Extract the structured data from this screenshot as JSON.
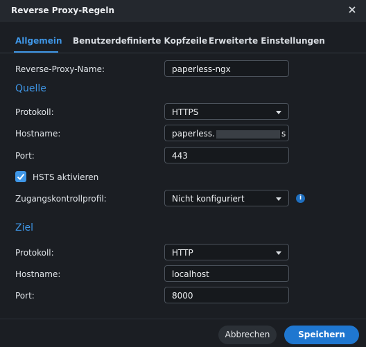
{
  "window": {
    "title": "Reverse Proxy-Regeln"
  },
  "tabs": [
    "Allgemein",
    "Benutzerdefinierte Kopfzeile",
    "Erweiterte Einstellungen"
  ],
  "general": {
    "name_label": "Reverse-Proxy-Name:",
    "name_value": "paperless-ngx"
  },
  "source": {
    "heading": "Quelle",
    "protocol_label": "Protokoll:",
    "protocol_value": "HTTPS",
    "hostname_label": "Hostname:",
    "hostname_prefix": "paperless.",
    "hostname_suffix": "s",
    "port_label": "Port:",
    "port_value": "443",
    "hsts_label": "HSTS aktivieren",
    "access_label": "Zugangskontrollprofil:",
    "access_value": "Nicht konfiguriert"
  },
  "destination": {
    "heading": "Ziel",
    "protocol_label": "Protokoll:",
    "protocol_value": "HTTP",
    "hostname_label": "Hostname:",
    "hostname_value": "localhost",
    "port_label": "Port:",
    "port_value": "8000"
  },
  "footer": {
    "cancel_label": "Abbrechen",
    "save_label": "Speichern"
  },
  "icons": {
    "close": "close-icon",
    "info": "info-icon",
    "check": "check-icon",
    "dropdown": "chevron-down-icon"
  },
  "colors": {
    "accent": "#3f96e6",
    "background": "#1b1e23",
    "primary_button": "#1f77d0"
  }
}
